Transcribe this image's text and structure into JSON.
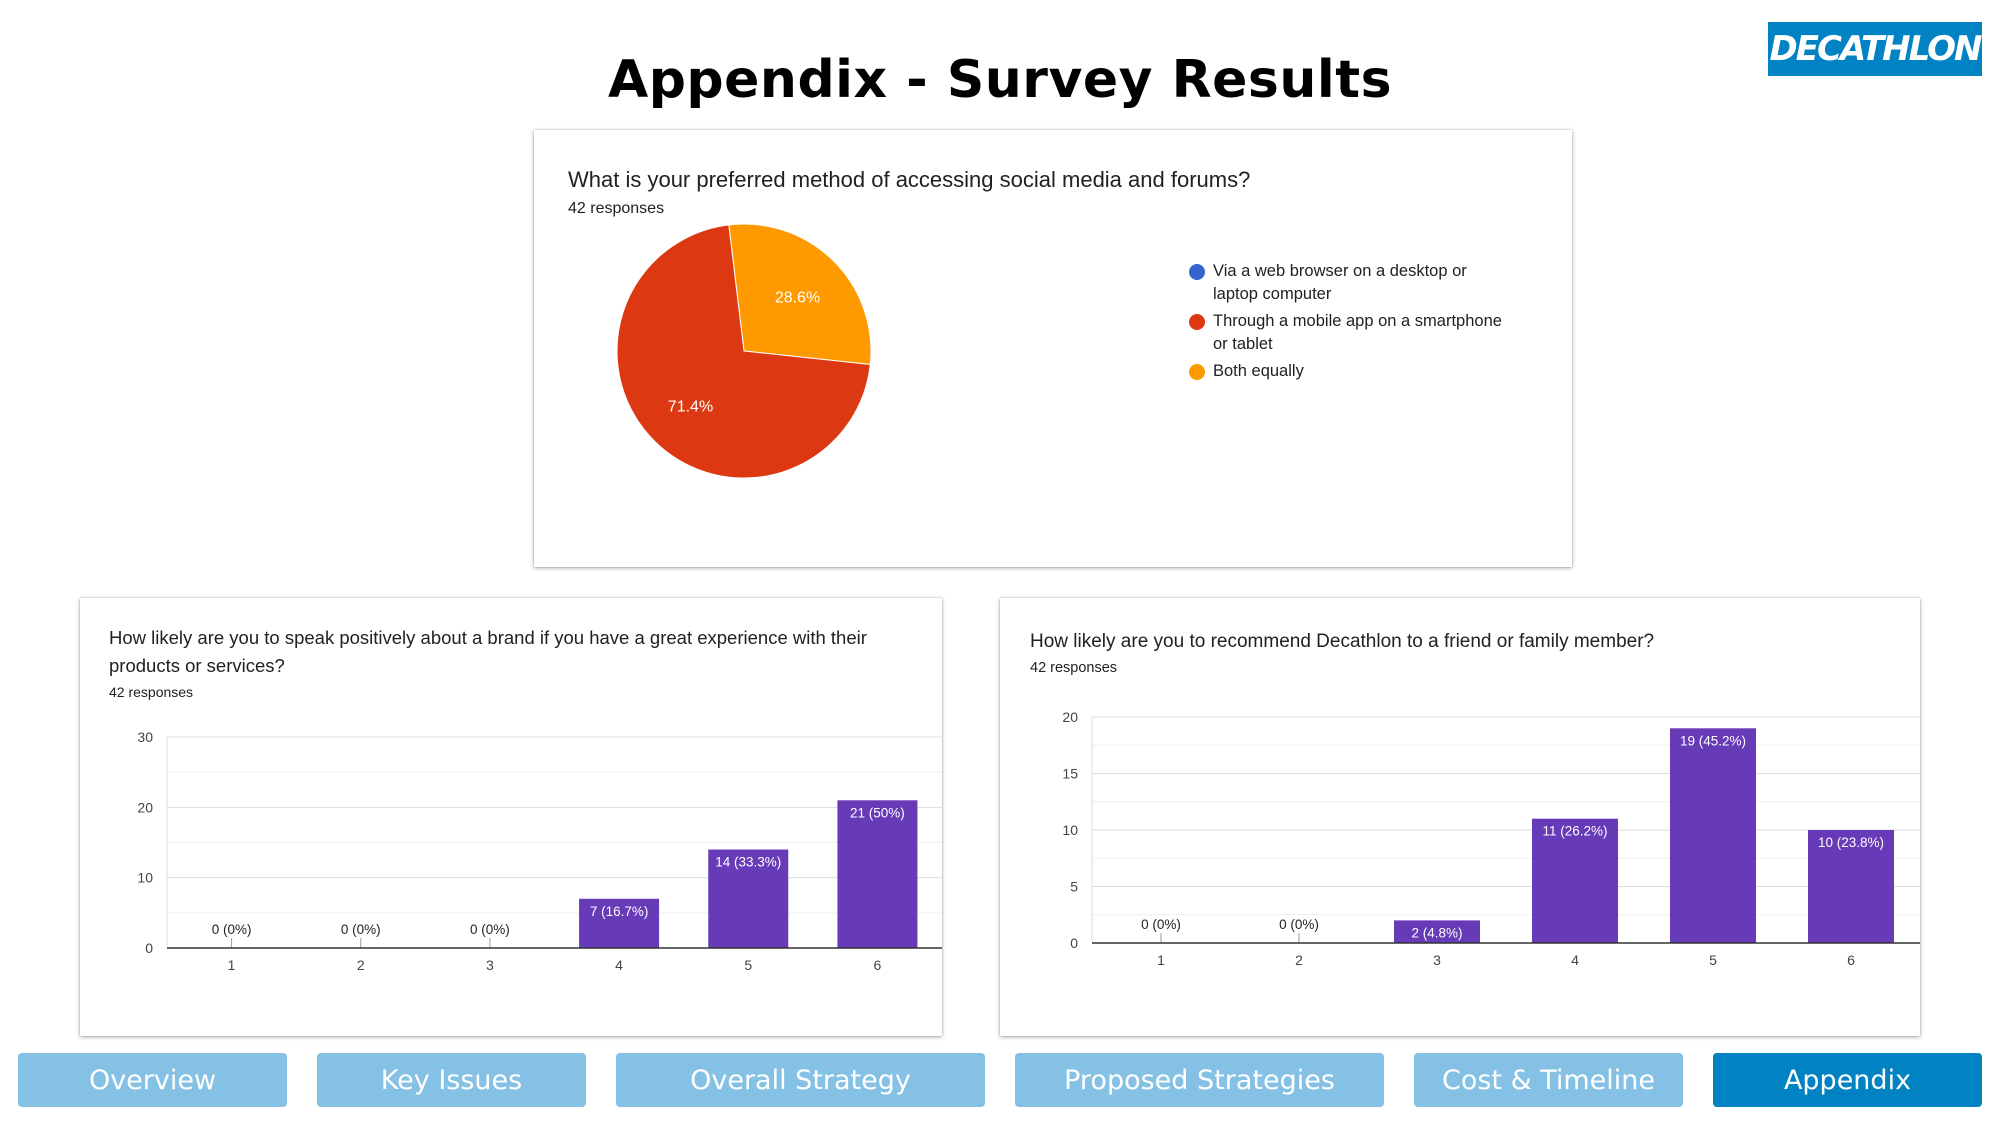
{
  "page_title": "Appendix - Survey Results",
  "logo_text": "DECATHLON",
  "colors": {
    "brand_blue": "#0082c3",
    "nav_inactive": "#85c1e5",
    "bar_purple": "#673ab7",
    "pie_blue": "#3366cc",
    "pie_red": "#dc3912",
    "pie_orange": "#ff9900"
  },
  "pie_card": {
    "question": "What is your preferred method of accessing social media and forums?",
    "responses": "42 responses"
  },
  "bar_card_left": {
    "question": "How likely are you to speak positively about a brand if you have a great experience with their products or services?",
    "responses": "42 responses"
  },
  "bar_card_right": {
    "question": "How likely are you to recommend Decathlon to a friend or family member?",
    "responses": "42 responses"
  },
  "chart_data": [
    {
      "type": "pie",
      "title": "What is your preferred method of accessing social media and forums?",
      "labels": [
        "Via a web browser on a desktop or laptop computer",
        "Through a mobile app on a smartphone or tablet",
        "Both equally"
      ],
      "label_lines": [
        [
          "Via a web browser on a desktop or",
          "laptop computer"
        ],
        [
          "Through a mobile app on a smartphone",
          "or tablet"
        ],
        [
          "Both equally"
        ]
      ],
      "values": [
        0,
        71.4,
        28.6
      ],
      "value_labels": [
        "",
        "71.4%",
        "28.6%"
      ],
      "colors": [
        "#3366cc",
        "#dc3912",
        "#ff9900"
      ],
      "legend_position": "right"
    },
    {
      "type": "bar",
      "title": "How likely are you to speak positively about a brand if you have a great experience with their products or services?",
      "categories": [
        "1",
        "2",
        "3",
        "4",
        "5",
        "6"
      ],
      "values": [
        0,
        0,
        0,
        7,
        14,
        21
      ],
      "data_labels": [
        "0 (0%)",
        "0 (0%)",
        "0 (0%)",
        "7 (16.7%)",
        "14 (33.3%)",
        "21 (50%)"
      ],
      "ylim": [
        0,
        30
      ],
      "yticks": [
        "0",
        "10",
        "20",
        "30"
      ],
      "ytick_values": [
        0,
        10,
        20,
        30
      ],
      "grid": true,
      "color": "#673ab7"
    },
    {
      "type": "bar",
      "title": "How likely are you to recommend Decathlon to a friend or family member?",
      "categories": [
        "1",
        "2",
        "3",
        "4",
        "5",
        "6"
      ],
      "values": [
        0,
        0,
        2,
        11,
        19,
        10
      ],
      "data_labels": [
        "0 (0%)",
        "0 (0%)",
        "2 (4.8%)",
        "11 (26.2%)",
        "19 (45.2%)",
        "10 (23.8%)"
      ],
      "ylim": [
        0,
        20
      ],
      "yticks": [
        "0",
        "5",
        "10",
        "15",
        "20"
      ],
      "ytick_values": [
        0,
        5,
        10,
        15,
        20
      ],
      "grid": true,
      "color": "#673ab7"
    }
  ],
  "nav": [
    {
      "label": "Overview",
      "active": false
    },
    {
      "label": "Key Issues",
      "active": false
    },
    {
      "label": "Overall Strategy",
      "active": false
    },
    {
      "label": "Proposed Strategies",
      "active": false
    },
    {
      "label": "Cost & Timeline",
      "active": false
    },
    {
      "label": "Appendix",
      "active": true
    }
  ]
}
